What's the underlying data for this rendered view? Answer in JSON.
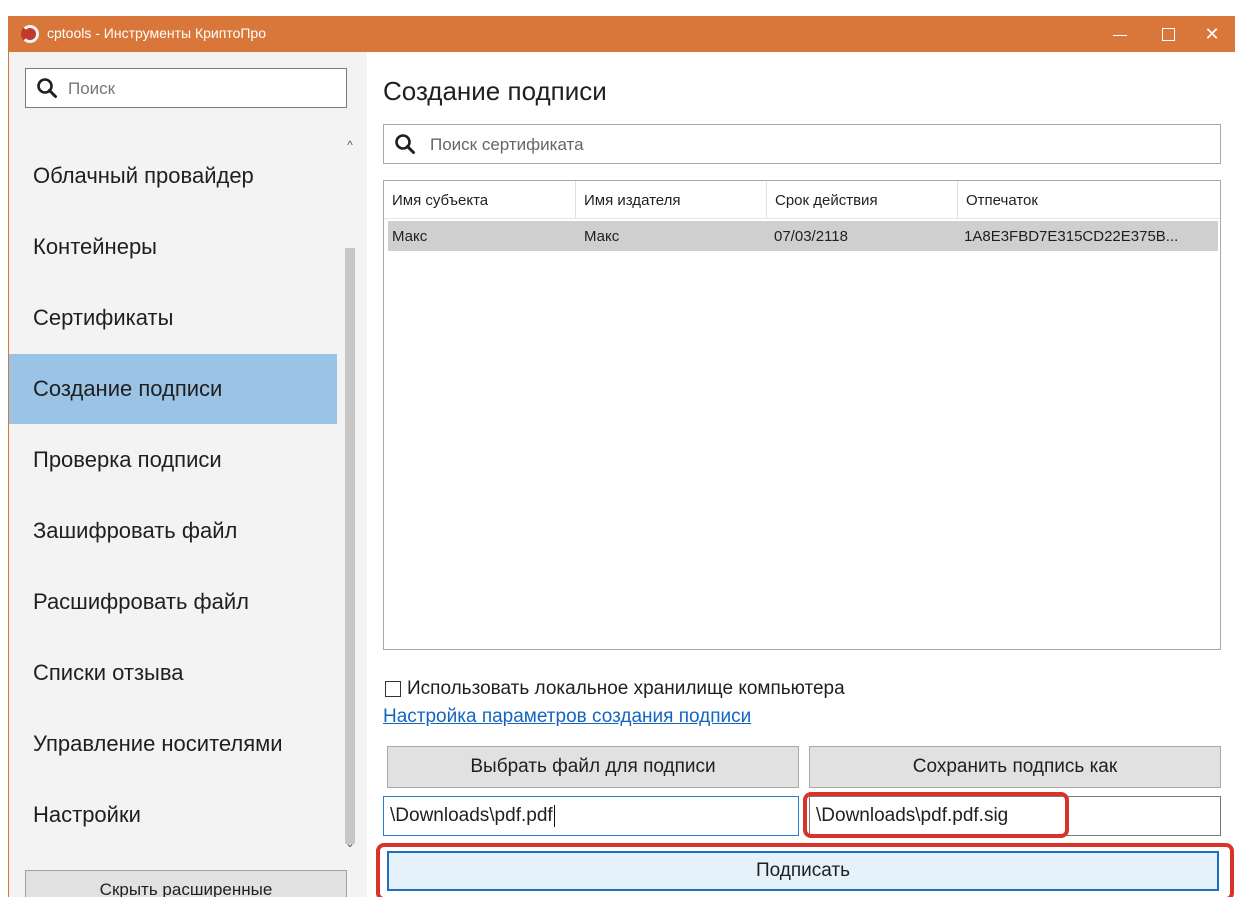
{
  "window": {
    "title": "cptools - Инструменты КриптоПро",
    "minimize_icon": "minimize-icon",
    "maximize_icon": "maximize-icon",
    "close_glyph": "✕"
  },
  "sidebar": {
    "search_placeholder": "Поиск",
    "items": [
      {
        "label": "Облачный провайдер",
        "active": false
      },
      {
        "label": "Контейнеры",
        "active": false
      },
      {
        "label": "Сертификаты",
        "active": false
      },
      {
        "label": "Создание подписи",
        "active": true
      },
      {
        "label": "Проверка подписи",
        "active": false
      },
      {
        "label": "Зашифровать файл",
        "active": false
      },
      {
        "label": "Расшифровать файл",
        "active": false
      },
      {
        "label": "Списки отзыва",
        "active": false
      },
      {
        "label": "Управление носителями",
        "active": false
      },
      {
        "label": "Настройки",
        "active": false
      }
    ],
    "hide_button": "Скрыть расширенные"
  },
  "main": {
    "title": "Создание подписи",
    "cert_search_placeholder": "Поиск сертификата",
    "table": {
      "columns": [
        "Имя субъекта",
        "Имя издателя",
        "Срок действия",
        "Отпечаток"
      ],
      "rows": [
        [
          "Макс",
          "Макс",
          "07/03/2118",
          "1A8E3FBD7E315CD22E375B..."
        ]
      ]
    },
    "local_store_checkbox": {
      "label": "Использовать локальное хранилище компьютера",
      "checked": false
    },
    "settings_link": "Настройка параметров создания подписи",
    "choose_file_button": "Выбрать файл для подписи",
    "save_as_button": "Сохранить подпись как",
    "source_path": "\\Downloads\\pdf.pdf",
    "signature_path": "\\Downloads\\pdf.pdf.sig",
    "sign_button": "Подписать"
  },
  "colors": {
    "titlebar": "#d9773a",
    "active_nav": "#9ac3e6",
    "highlight": "#d9342b",
    "link": "#1565c0"
  }
}
